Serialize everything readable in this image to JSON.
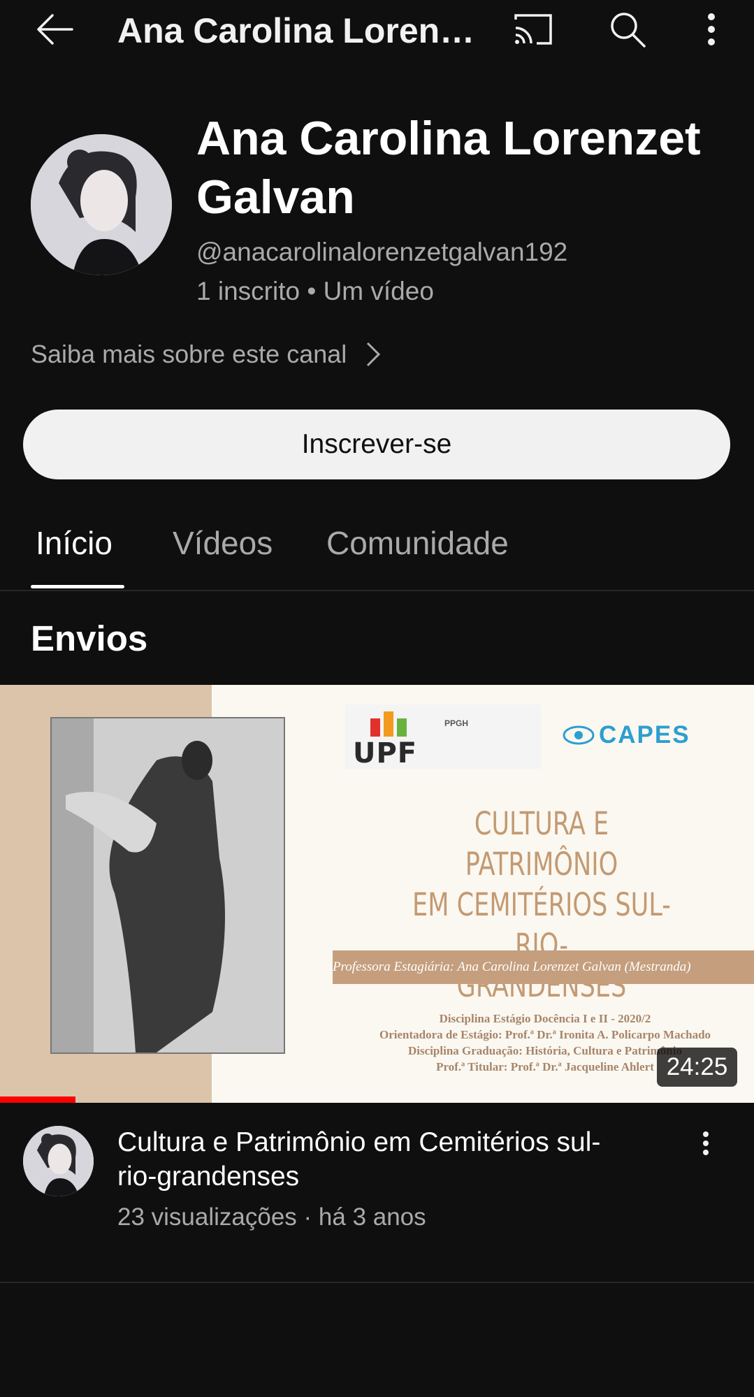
{
  "app_bar": {
    "title": "Ana Carolina Loren…",
    "icons": [
      "back-arrow-icon",
      "cast-icon",
      "search-icon",
      "more-vert-icon"
    ]
  },
  "channel": {
    "name": "Ana Carolina Lorenzet Galvan",
    "handle": "@anacarolinalorenzetgalvan192",
    "stats": "1 inscrito • Um vídeo",
    "more_about": "Saiba mais sobre este canal",
    "subscribe_label": "Inscrever-se"
  },
  "tabs": [
    {
      "label": "Início",
      "active": true
    },
    {
      "label": "Vídeos",
      "active": false
    },
    {
      "label": "Comunidade",
      "active": false
    }
  ],
  "section": {
    "title": "Envios"
  },
  "video": {
    "thumbnail": {
      "logo_upf": "UPF",
      "logo_ppgh": "PPGH",
      "logo_capes": "CAPES",
      "title_lines": [
        "CULTURA E PATRIMÔNIO",
        "EM CEMITÉRIOS SUL-RIO-",
        "GRANDENSES"
      ],
      "band_text": "Professora Estagiária: Ana Carolina Lorenzet Galvan (Mestranda)",
      "info_lines": [
        "Disciplina Estágio Docência I e II - 2020/2",
        "Orientadora de Estágio: Prof.ª Dr.ª Ironita A. Policarpo Machado",
        "Disciplina Graduação: História, Cultura e Patrimônio",
        "Prof.ª Titular: Prof.ª Dr.ª Jacqueline Ahlert"
      ]
    },
    "duration": "24:25",
    "watched_fraction": 0.1,
    "title": "Cultura e Patrimônio em Cemitérios sul-rio-grandenses",
    "meta": "23 visualizações · há 3 anos"
  },
  "colors": {
    "background": "#0f0f0f",
    "text_primary": "#f1f1f1",
    "text_secondary": "#aaaaaa",
    "progress_red": "#ff0000",
    "thumb_accent": "#c49e7d"
  }
}
